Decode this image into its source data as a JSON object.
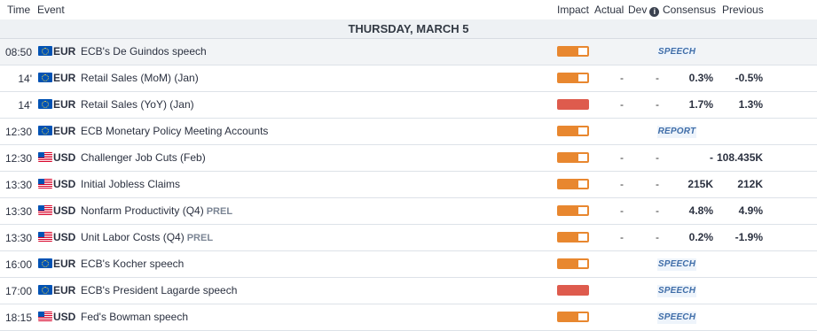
{
  "header": {
    "time": "Time",
    "event": "Event",
    "impact": "Impact",
    "actual": "Actual",
    "dev": "Dev",
    "consensus": "Consensus",
    "previous": "Previous"
  },
  "day_label": "THURSDAY, MARCH 5",
  "colors": {
    "impact_medium": "#e8872f",
    "impact_high": "#de5b4d",
    "badge_text": "#3f6da8"
  },
  "events": [
    {
      "time": "08:50",
      "currency": "EUR",
      "flag": "eu-flag-icon",
      "name": "ECB's De Guindos speech",
      "tag": "",
      "impact": "medium",
      "actual": "",
      "dev": "",
      "consensus": "",
      "previous": "",
      "badge": "SPEECH"
    },
    {
      "time": "14'",
      "currency": "EUR",
      "flag": "eu-flag-icon",
      "name": "Retail Sales (MoM) (Jan)",
      "tag": "",
      "impact": "medium",
      "actual": "-",
      "dev": "-",
      "consensus": "0.3%",
      "previous": "-0.5%",
      "badge": ""
    },
    {
      "time": "14'",
      "currency": "EUR",
      "flag": "eu-flag-icon",
      "name": "Retail Sales (YoY) (Jan)",
      "tag": "",
      "impact": "high",
      "actual": "-",
      "dev": "-",
      "consensus": "1.7%",
      "previous": "1.3%",
      "badge": ""
    },
    {
      "time": "12:30",
      "currency": "EUR",
      "flag": "eu-flag-icon",
      "name": "ECB Monetary Policy Meeting Accounts",
      "tag": "",
      "impact": "medium",
      "actual": "",
      "dev": "",
      "consensus": "",
      "previous": "",
      "badge": "REPORT"
    },
    {
      "time": "12:30",
      "currency": "USD",
      "flag": "us-flag-icon",
      "name": "Challenger Job Cuts (Feb)",
      "tag": "",
      "impact": "medium",
      "actual": "-",
      "dev": "-",
      "consensus": "-",
      "previous": "108.435K",
      "badge": ""
    },
    {
      "time": "13:30",
      "currency": "USD",
      "flag": "us-flag-icon",
      "name": "Initial Jobless Claims",
      "tag": "",
      "impact": "medium",
      "actual": "-",
      "dev": "-",
      "consensus": "215K",
      "previous": "212K",
      "badge": ""
    },
    {
      "time": "13:30",
      "currency": "USD",
      "flag": "us-flag-icon",
      "name": "Nonfarm Productivity (Q4)",
      "tag": "PREL",
      "impact": "medium",
      "actual": "-",
      "dev": "-",
      "consensus": "4.8%",
      "previous": "4.9%",
      "badge": ""
    },
    {
      "time": "13:30",
      "currency": "USD",
      "flag": "us-flag-icon",
      "name": "Unit Labor Costs (Q4)",
      "tag": "PREL",
      "impact": "medium",
      "actual": "-",
      "dev": "-",
      "consensus": "0.2%",
      "previous": "-1.9%",
      "badge": ""
    },
    {
      "time": "16:00",
      "currency": "EUR",
      "flag": "eu-flag-icon",
      "name": "ECB's Kocher speech",
      "tag": "",
      "impact": "medium",
      "actual": "",
      "dev": "",
      "consensus": "",
      "previous": "",
      "badge": "SPEECH"
    },
    {
      "time": "17:00",
      "currency": "EUR",
      "flag": "eu-flag-icon",
      "name": "ECB's President Lagarde speech",
      "tag": "",
      "impact": "high",
      "actual": "",
      "dev": "",
      "consensus": "",
      "previous": "",
      "badge": "SPEECH"
    },
    {
      "time": "18:15",
      "currency": "USD",
      "flag": "us-flag-icon",
      "name": "Fed's Bowman speech",
      "tag": "",
      "impact": "medium",
      "actual": "",
      "dev": "",
      "consensus": "",
      "previous": "",
      "badge": "SPEECH"
    }
  ]
}
